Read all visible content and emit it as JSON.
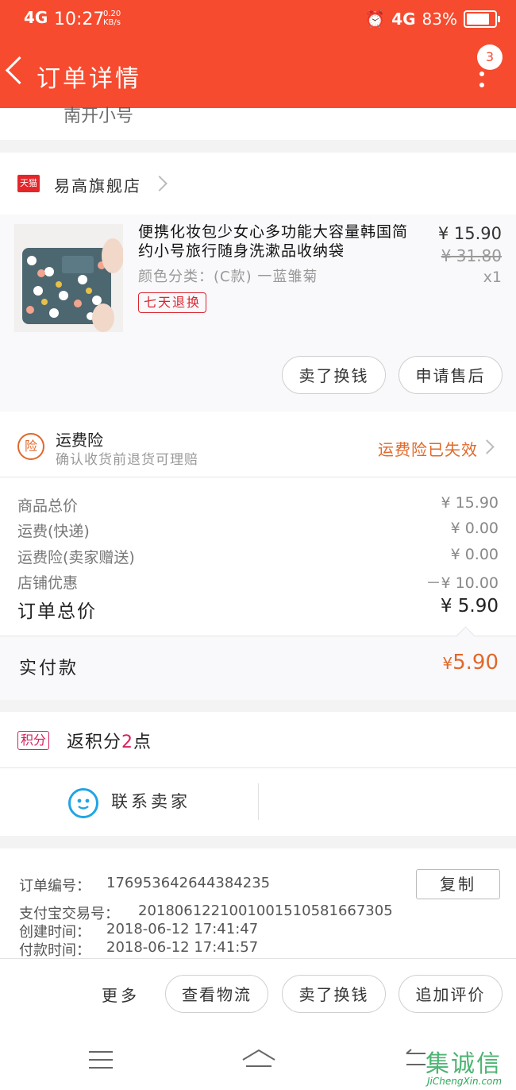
{
  "status_bar": {
    "network_left": "4G",
    "time": "10:27",
    "speed_value": "0.20",
    "speed_unit": "KB/s",
    "network_right": "4G",
    "battery": "83%"
  },
  "header": {
    "title": "订单详情",
    "badge_count": "3"
  },
  "partial_text": "南开小号",
  "shop": {
    "badge": "天猫",
    "name": "易高旗舰店"
  },
  "product": {
    "title": "便携化妆包少女心多功能大容量韩国简约小号旅行随身洗漱品收纳袋",
    "variant": "颜色分类：(C款) 一蓝雏菊",
    "tag": "七天退换",
    "price": "¥ 15.90",
    "original_price": "¥ 31.80",
    "quantity": "x1",
    "button_sell": "卖了换钱",
    "button_after_sale": "申请售后"
  },
  "insurance": {
    "icon_text": "险",
    "title": "运费险",
    "subtitle": "确认收货前退货可理赔",
    "status": "运费险已失效"
  },
  "summary": {
    "rows": [
      {
        "label": "商品总价",
        "value": "¥ 15.90"
      },
      {
        "label": "运费(快递)",
        "value": "¥ 0.00"
      },
      {
        "label": "运费险(卖家赠送)",
        "value": "¥ 0.00"
      },
      {
        "label": "店铺优惠",
        "value": "－¥ 10.00"
      }
    ],
    "total_label": "订单总价",
    "total_value": "¥ 5.90",
    "paid_label": "实付款",
    "paid_symbol": "¥",
    "paid_value": "5.90"
  },
  "points": {
    "badge": "积分",
    "text_prefix": "返积分",
    "count": "2",
    "text_suffix": "点"
  },
  "contact": {
    "label": "联系卖家"
  },
  "order_info": {
    "order_no_label": "订单编号：",
    "order_no": "176953642644384235",
    "copy_button": "复制",
    "alipay_label": "支付宝交易号：",
    "alipay_no": "2018061221001001510581667305",
    "created_label": "创建时间：",
    "created_time": "2018-06-12 17:41:47",
    "paid_label": "付款时间：",
    "paid_time": "2018-06-12 17:41:57"
  },
  "bottom_bar": {
    "more": "更多",
    "logistics": "查看物流",
    "sell": "卖了换钱",
    "review": "追加评价"
  },
  "watermark": {
    "text": "集诚信",
    "domain": "JiChengXin.com"
  },
  "colors": {
    "header_red": "#f64b2f",
    "accent_orange": "#e0682a",
    "tag_red": "#d9262e",
    "points_pink": "#d6205a"
  }
}
